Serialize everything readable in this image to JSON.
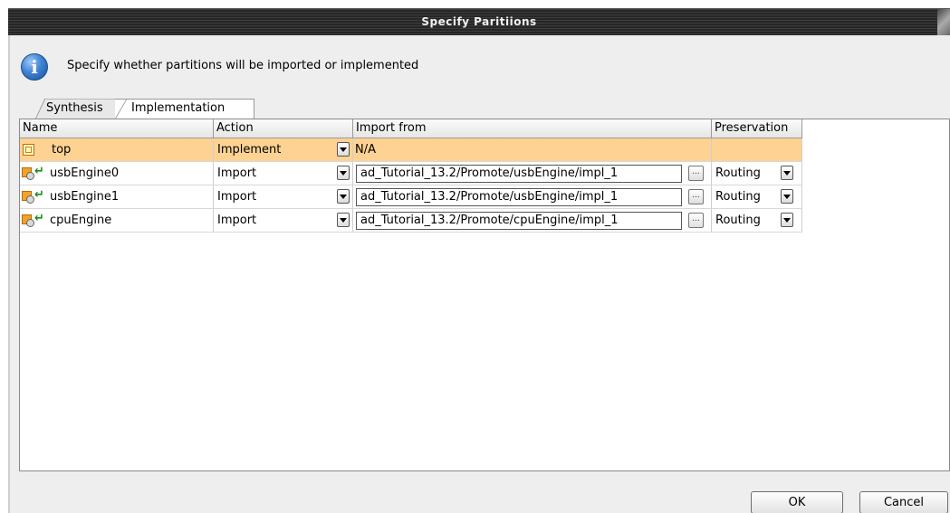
{
  "window": {
    "title": "Specify Paritiions"
  },
  "message": "Specify whether partitions will be imported or implemented",
  "tabs": [
    {
      "label": "Synthesis"
    },
    {
      "label": "Implementation"
    }
  ],
  "table": {
    "columns": [
      "Name",
      "Action",
      "Import from",
      "Preservation"
    ],
    "rows": [
      {
        "name": "top",
        "action": "Implement",
        "import_from": "N/A",
        "preservation": ""
      },
      {
        "name": "usbEngine0",
        "action": "Import",
        "import_from": "ad_Tutorial_13.2/Promote/usbEngine/impl_1",
        "preservation": "Routing"
      },
      {
        "name": "usbEngine1",
        "action": "Import",
        "import_from": "ad_Tutorial_13.2/Promote/usbEngine/impl_1",
        "preservation": "Routing"
      },
      {
        "name": "cpuEngine",
        "action": "Import",
        "import_from": "ad_Tutorial_13.2/Promote/cpuEngine/impl_1",
        "preservation": "Routing"
      }
    ]
  },
  "buttons": {
    "ok": "OK",
    "cancel": "Cancel",
    "browse": "..."
  },
  "icons": {
    "info": "info-icon",
    "top_partition": "top-partition-icon",
    "imported_partition": "imported-partition-icon"
  },
  "colors": {
    "selected_row": "#fdd292",
    "titlebar": "#2e2e2e"
  }
}
